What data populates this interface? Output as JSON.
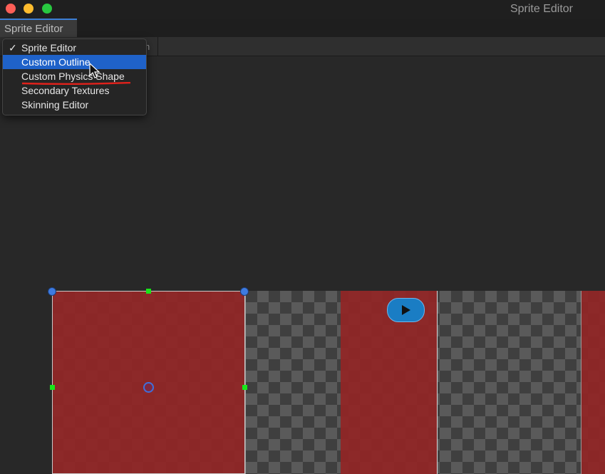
{
  "window": {
    "title": "Sprite Editor"
  },
  "tab": {
    "label": "Sprite Editor"
  },
  "toolbar": {
    "fragment": "n"
  },
  "menu": {
    "items": [
      {
        "label": "Sprite Editor",
        "checked": true
      },
      {
        "label": "Custom Outline",
        "highlighted": true
      },
      {
        "label": "Custom Physics Shape",
        "underlined": true
      },
      {
        "label": "Secondary Textures"
      },
      {
        "label": "Skinning Editor"
      }
    ],
    "check_icon": "checkmark-icon"
  },
  "colors": {
    "highlight": "#1f62c9",
    "underline": "#e0211b",
    "sprite_overlay": "#912626",
    "handle_blue": "#3e7be0",
    "handle_green": "#19e619",
    "play_button": "#1a7dc4"
  },
  "icons": {
    "play": "play-icon",
    "cursor": "pointer-cursor-icon"
  }
}
